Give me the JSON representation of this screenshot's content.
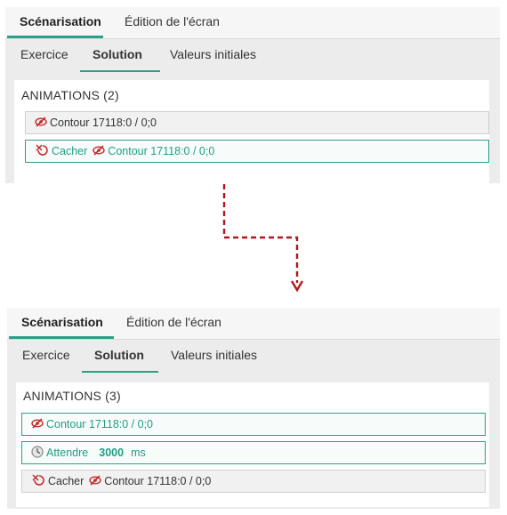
{
  "colors": {
    "accent": "#2b9f87",
    "teal_text": "#1f9e84",
    "arrow": "#b5161b"
  },
  "before": {
    "tabs": [
      "Scénarisation",
      "Édition de l'écran"
    ],
    "subtabs": [
      "Exercice",
      "Solution",
      "Valeurs initiales"
    ],
    "section_title": "ANIMATIONS (2)",
    "rows": [
      {
        "text": "Contour 17118:0 / 0;0"
      },
      {
        "action": "Cacher",
        "text": "Contour 17118:0 / 0;0"
      }
    ]
  },
  "after": {
    "tabs": [
      "Scénarisation",
      "Édition de l'écran"
    ],
    "subtabs": [
      "Exercice",
      "Solution",
      "Valeurs initiales"
    ],
    "section_title": "ANIMATIONS (3)",
    "rows": [
      {
        "text": "Contour 17118:0 / 0;0"
      },
      {
        "action": "Attendre",
        "value": "3000",
        "unit": "ms"
      },
      {
        "action": "Cacher",
        "text": "Contour 17118:0 / 0;0"
      }
    ]
  },
  "icons": {
    "hidden": "eye-slash-icon",
    "hide_action": "hide-action-icon",
    "wait": "clock-icon"
  }
}
